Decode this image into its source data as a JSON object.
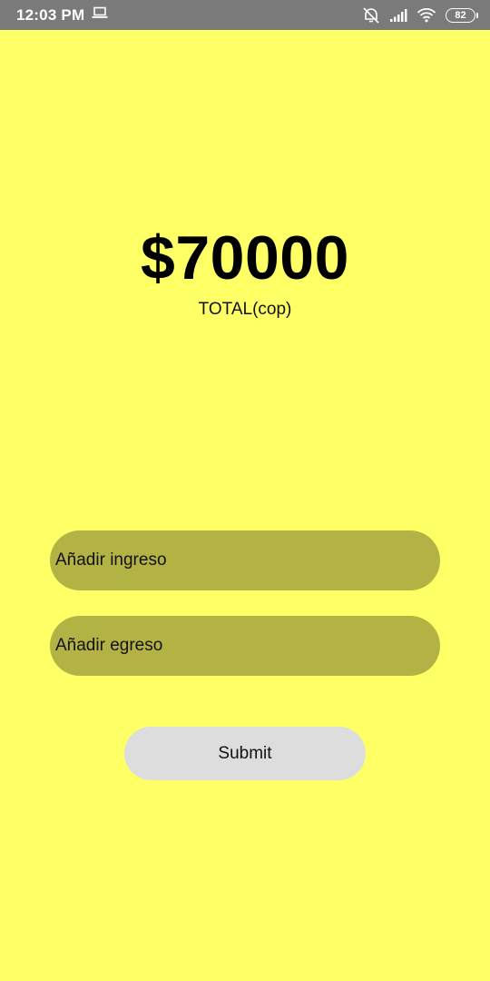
{
  "status_bar": {
    "time": "12:03 PM",
    "battery_level": "82",
    "icons": [
      "laptop-icon",
      "alarm-off-icon",
      "signal-icon",
      "wifi-icon",
      "battery-icon"
    ]
  },
  "summary": {
    "total_amount": "$70000",
    "total_label": "TOTAL(cop)"
  },
  "form": {
    "income_placeholder": "Añadir ingreso",
    "expense_placeholder": "Añadir egreso",
    "submit_label": "Submit"
  },
  "colors": {
    "background": "#ffff66",
    "input_fill": "#b3b345",
    "button_fill": "#dddddd",
    "status_bar": "#7a7a7a"
  }
}
